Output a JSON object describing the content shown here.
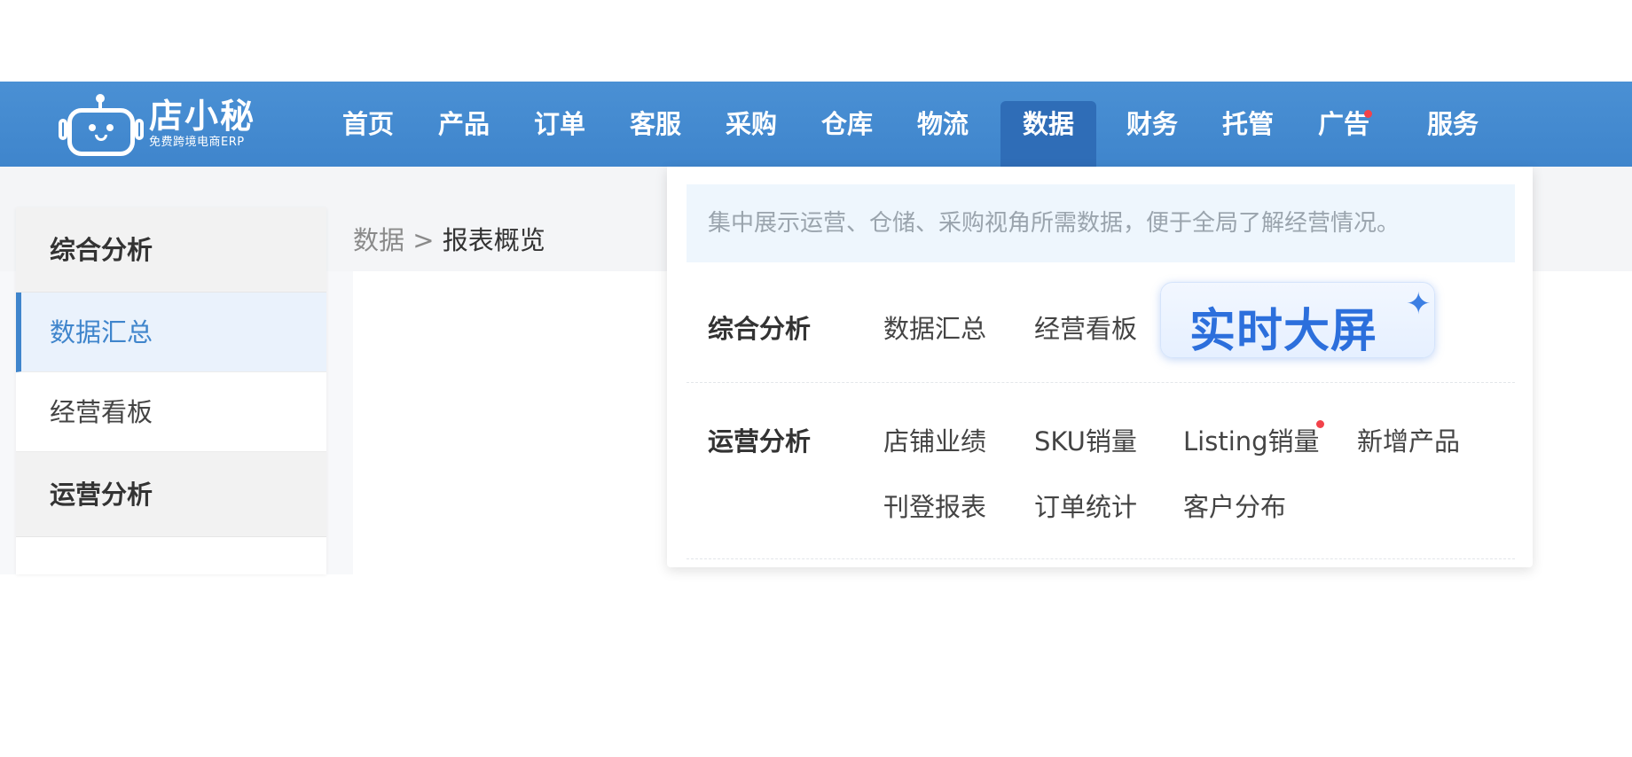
{
  "app": {
    "logo_title": "店小秘",
    "logo_subtitle": "免费跨境电商ERP"
  },
  "nav": {
    "items": [
      {
        "label": "首页"
      },
      {
        "label": "产品"
      },
      {
        "label": "订单"
      },
      {
        "label": "客服"
      },
      {
        "label": "采购"
      },
      {
        "label": "仓库"
      },
      {
        "label": "物流"
      },
      {
        "label": "数据",
        "active": true
      },
      {
        "label": "财务"
      },
      {
        "label": "托管"
      },
      {
        "label": "广告",
        "badge_dot": true
      },
      {
        "label": "服务"
      }
    ]
  },
  "breadcrumb": {
    "root": "数据",
    "separator": ">",
    "current": "报表概览"
  },
  "sidebar": {
    "groups": [
      {
        "title": "综合分析",
        "items": [
          {
            "label": "数据汇总",
            "active": true
          },
          {
            "label": "经营看板"
          }
        ]
      },
      {
        "title": "运营分析",
        "items": []
      }
    ]
  },
  "dropdown": {
    "description": "集中展示运营、仓储、采购视角所需数据，便于全局了解经营情况。",
    "sections": [
      {
        "title": "综合分析",
        "links": [
          "数据汇总",
          "经营看板"
        ],
        "featured": "实时大屏"
      },
      {
        "title": "运营分析",
        "links": [
          "店铺业绩",
          "SKU销量",
          "Listing销量",
          "新增产品",
          "刊登报表",
          "订单统计",
          "客户分布"
        ]
      }
    ]
  },
  "colors": {
    "topbar": "#4a90d4",
    "active_nav": "#2f6db7",
    "accent": "#3f85cc",
    "badge": "#f2424a",
    "featured": "#2c6fdc"
  }
}
